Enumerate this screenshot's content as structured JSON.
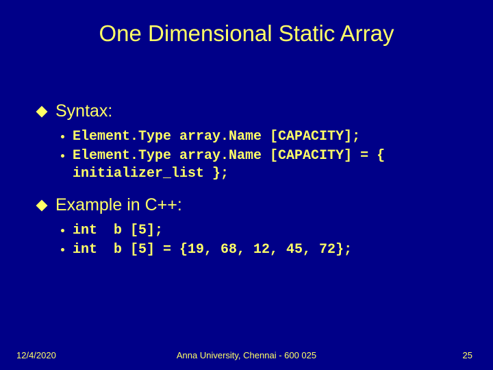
{
  "slide": {
    "title": "One Dimensional Static Array",
    "sections": [
      {
        "heading": "Syntax:",
        "items": [
          "Element.Type array.Name [CAPACITY];",
          "Element.Type array.Name [CAPACITY] = { initializer_list };"
        ]
      },
      {
        "heading": "Example in C++:",
        "items": [
          "int  b [5];",
          "int  b [5] = {19, 68, 12, 45, 72};"
        ]
      }
    ]
  },
  "footer": {
    "date": "12/4/2020",
    "org": "Anna University, Chennai - 600 025",
    "page": "25"
  }
}
